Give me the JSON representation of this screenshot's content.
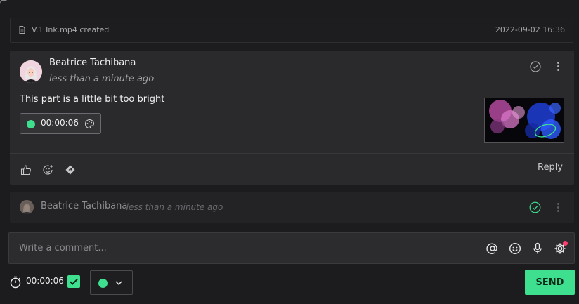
{
  "colors": {
    "accent": "#3ee08f",
    "background": "#1c1c1e",
    "card": "#2a2a2d",
    "badge": "#ff3d6e"
  },
  "event": {
    "text": "V.1 Ink.mp4 created",
    "date": "2022-09-02 16:36",
    "icon": "file-icon"
  },
  "comment": {
    "author": "Beatrice Tachibana",
    "time": "less than a minute ago",
    "text": "This part is a little bit too bright",
    "timestamp": "00:00:06",
    "reply_label": "Reply",
    "icons": [
      "check-circle-icon",
      "more-vertical-icon",
      "thumbs-up-icon",
      "emoji-add-icon",
      "diamond-icon",
      "palette-icon"
    ]
  },
  "reply": {
    "author": "Beatrice Tachibana",
    "time": "· less than a minute ago"
  },
  "composer": {
    "placeholder": "Write a comment...",
    "icons": [
      "at-icon",
      "emoji-icon",
      "microphone-icon",
      "settings-icon"
    ]
  },
  "footer": {
    "timer": "00:00:06",
    "send_label": "SEND",
    "timer_checked": true,
    "selected_color": "#3ee08f"
  }
}
